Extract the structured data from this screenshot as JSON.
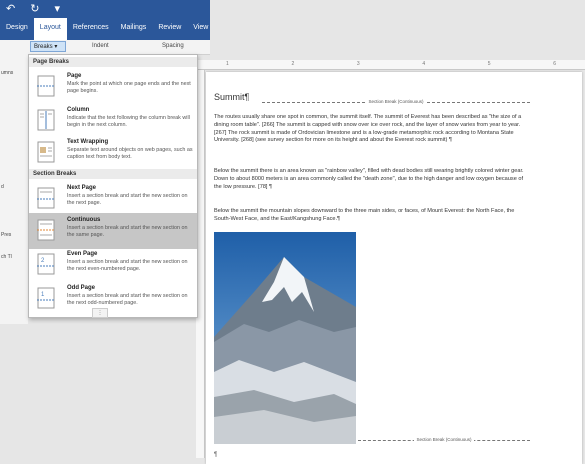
{
  "ribbon": {
    "quick_access": "↶ ↻ ▾",
    "tabs": [
      "Design",
      "Layout",
      "References",
      "Mailings",
      "Review",
      "View"
    ],
    "active_tab": "Layout",
    "breaks_label": "Breaks ▾",
    "indent_label": "Indent",
    "spacing_label": "Spacing",
    "left_fragments": [
      "umns",
      "d",
      "Pres",
      "ch Tl"
    ]
  },
  "menu": {
    "page_breaks_header": "Page Breaks",
    "section_breaks_header": "Section Breaks",
    "items": [
      {
        "title": "Page",
        "desc": "Mark the point at which one page ends and the next page begins."
      },
      {
        "title": "Column",
        "desc": "Indicate that the text following the column break will begin in the next column."
      },
      {
        "title": "Text Wrapping",
        "desc": "Separate text around objects on web pages, such as caption text from body text."
      },
      {
        "title": "Next Page",
        "desc": "Insert a section break and start the new section on the next page."
      },
      {
        "title": "Continuous",
        "desc": "Insert a section break and start the new section on the same page."
      },
      {
        "title": "Even Page",
        "desc": "Insert a section break and start the new section on the next even-numbered page."
      },
      {
        "title": "Odd Page",
        "desc": "Insert a section break and start the new section on the next odd-numbered page."
      }
    ],
    "selected": "Continuous"
  },
  "ruler": {
    "ticks": [
      "1",
      "2",
      "3",
      "4",
      "5",
      "6"
    ]
  },
  "document": {
    "title": "Summit¶",
    "section_break_label": "Section Break (Continuous)",
    "paragraphs": [
      "The routes usually share one spot in common, the summit itself. The summit of Everest has been described as \"the size of a dining room table\". [266] The summit is capped with snow over ice over rock, and the layer of snow varies from year to year. [267] The rock summit is made of Ordovician limestone and is a low-grade metamorphic rock according to Montana State University. [268] (see survey section for more on its height and about the Everest rock summit) ¶",
      "Below the summit there is an area known as \"rainbow valley\", filled with dead bodies still wearing brightly colored winter gear. Down to about 8000 meters is an area commonly called the \"death zone\", due to the high danger and low oxygen because of the low pressure. [78] ¶",
      "Below the summit the mountain slopes downward to the three main sides, or faces, of Mount Everest: the North Face, the South-West Face, and the East/Kangshung Face.¶"
    ],
    "end_mark": "¶"
  }
}
